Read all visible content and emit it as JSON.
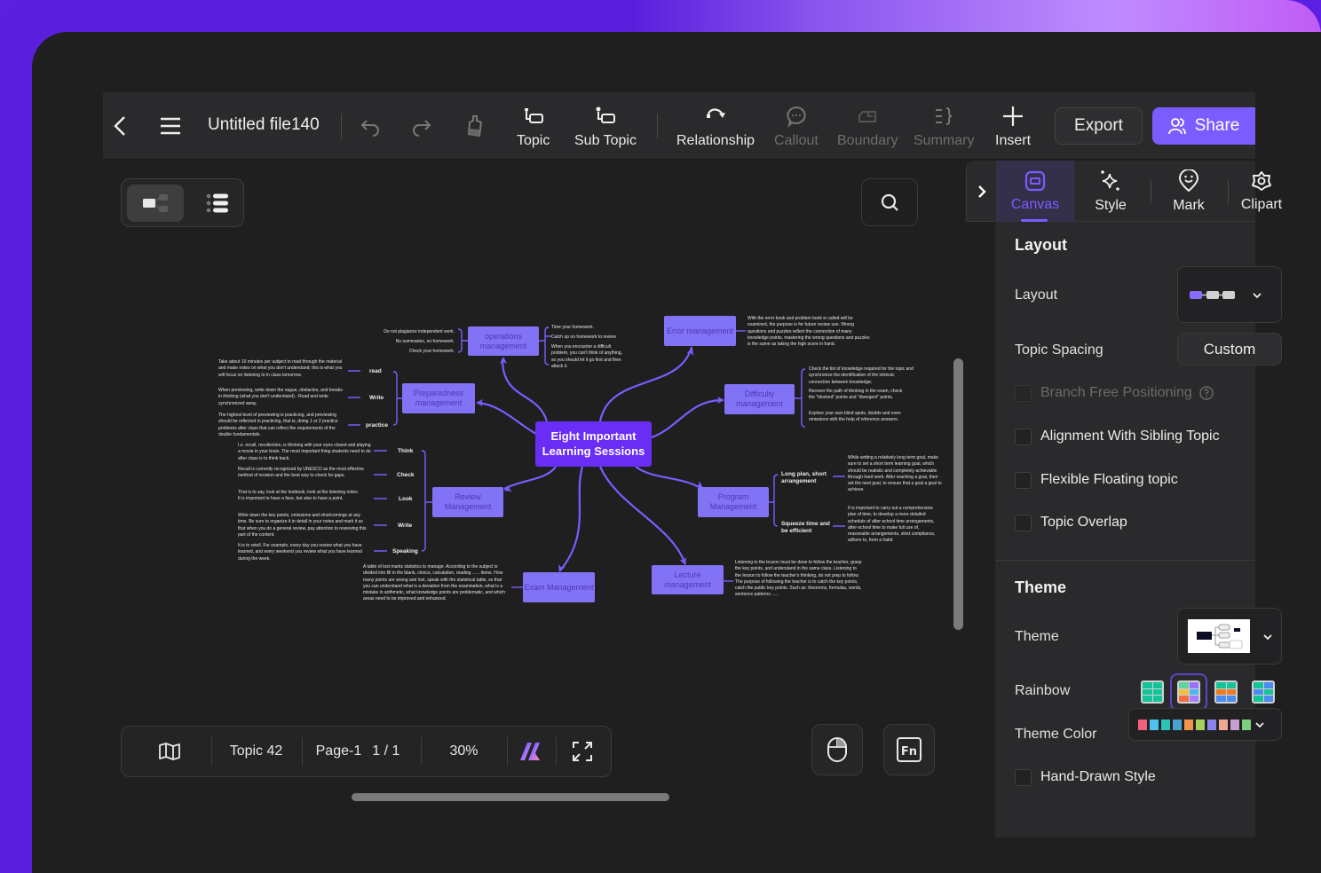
{
  "toolbar": {
    "back_icon": "chevron-left-icon",
    "menu_icon": "hamburger-menu-icon",
    "file_title": "Untitled file140",
    "undo_icon": "undo-icon",
    "redo_icon": "redo-icon",
    "format_painter_icon": "format-painter-icon",
    "tools": [
      {
        "label": "Topic",
        "icon": "topic-icon",
        "enabled": true
      },
      {
        "label": "Sub Topic",
        "icon": "sub-topic-icon",
        "enabled": true
      },
      {
        "label": "Relationship",
        "icon": "relationship-icon",
        "enabled": true
      },
      {
        "label": "Callout",
        "icon": "callout-icon",
        "enabled": false
      },
      {
        "label": "Boundary",
        "icon": "boundary-icon",
        "enabled": false
      },
      {
        "label": "Summary",
        "icon": "summary-icon",
        "enabled": false
      },
      {
        "label": "Insert",
        "icon": "plus-icon",
        "enabled": true
      }
    ],
    "export_label": "Export",
    "share_label": "Share"
  },
  "canvas": {
    "view_modes": [
      "mind-map-view",
      "outline-view"
    ],
    "active_view": "mind-map-view",
    "search_icon": "search-icon"
  },
  "mindmap": {
    "root": "Eight Important Learning Sessions",
    "branches": {
      "operations": {
        "title": "operations management",
        "left_notes": [
          "Do not plagiarize independent work.",
          "No summaries, no homework.",
          "Check your homework."
        ],
        "right_notes": [
          "Time your homework.",
          "Catch up on homework to review",
          "When you encounter a difficult problem, you can't think of anything, so you should let it go first and then attack it."
        ]
      },
      "error": {
        "title": "Error management",
        "note": "With the error book and problem book is called will be examined, the purpose is for future review use. Wrong questions and puzzles reflect the connection of many knowledge points, mastering the wrong questions and puzzles is the same as taking the high score in hand."
      },
      "preparedness": {
        "title": "Preparedness management",
        "subs": [
          {
            "label": "read",
            "note": "Take about 10 minutes per subject to read through the material and make notes on what you don't understand; this is what you will focus on listening to in class tomorrow."
          },
          {
            "label": "Write",
            "note": "When previewing, write down the vague, obstacles, and breaks in thinking (what you don't understand). -Read and write synchronized away."
          },
          {
            "label": "practice",
            "note": "The highest level of previewing is practicing, and previewing should be reflected in practicing, that is, doing 1 or 2 practice problems after class that can reflect the requirements of the double fundamentals."
          }
        ]
      },
      "difficulty": {
        "title": "Difficulty management",
        "notes": [
          "Check the list of knowledge required for the topic and synchronize the identification of the intrinsic connection between knowledge;",
          "Recover the path of thinking in the exam, check the \"blocked\" points and \"divergent\" points.",
          "Explore your own blind spots, doubts and even omissions with the help of reference answers."
        ]
      },
      "review": {
        "title": "Review Management",
        "subs": [
          {
            "label": "Think",
            "note": "I.e. recall, recollection, is thinking with your eyes closed and playing a movie in your brain. The most important thing students need to do after class is to think back."
          },
          {
            "label": "Check",
            "note": "Recall is currently recognized by UNESCO as the most effective method of revision and the best way to check for gaps."
          },
          {
            "label": "Look",
            "note": "That is to say, look at the textbook, look at the listening notes. It is important to have a face, but also to have a point."
          },
          {
            "label": "Write",
            "note": "Write down the key points, omissions and shortcomings at any time. Be sure to organize it in detail in your notes and mark it so that when you do a general review, pay attention to reviewing this part of the content."
          },
          {
            "label": "Speaking",
            "note": "It is to retell. For example, every day you review what you have learned, and every weekend you review what you have learned during the week."
          }
        ]
      },
      "program": {
        "title": "Program Management",
        "subs": [
          {
            "label": "Long plan, short arrangement",
            "note": "While setting a relatively long term goal, make sure to set a short term learning goal, which should be realistic and completely achievable through hard work. After reaching a goal, then set the next goal, to ensure that a goal a goal to achieve."
          },
          {
            "label": "Squeeze time and be efficient",
            "note": "It is important to carry out a comprehensive plan of time, to develop a more detailed schedule of after-school time arrangements, after-school time to make full use of, reasonable arrangements, strict compliance, adhere to, form a habit."
          }
        ]
      },
      "exam": {
        "title": "Exam Management",
        "note": "A table of lost marks statistics to manage. According to the subject is divided into fill in the blank, choice, calculation, reading ...... items. How many points are wrong and lost, speak with the statistical table, so that you can understand what is a deviation from the examination, what is a mistake in arithmetic, what knowledge points are problematic, and which areas need to be improved and enhanced."
      },
      "lecture": {
        "title": "Lecture management",
        "note": "Listening to the lesson must be done to follow the teacher, grasp the key points, and understand in the same class. Listening to the lesson to follow the teacher's thinking, do not prep to follow. The purpose of following the teacher is to catch the key points, catch the public key points. Such as: theorems, formulas, words, sentence patterns ......"
      }
    }
  },
  "bottombar": {
    "map_icon": "map-icon",
    "topic_count": "Topic 42",
    "page_label": "Page-1",
    "page_count": "1 / 1",
    "zoom": "30%",
    "ai_icon": "ai-logo-icon",
    "fullscreen_icon": "fullscreen-icon",
    "mouse_icon": "mouse-icon",
    "fn_icon": "function-key-icon"
  },
  "panel": {
    "tabs": [
      {
        "label": "Canvas",
        "icon": "canvas-icon",
        "active": true
      },
      {
        "label": "Style",
        "icon": "sparkle-icon",
        "active": false
      },
      {
        "label": "Mark",
        "icon": "mark-icon",
        "active": false
      },
      {
        "label": "Clipart",
        "icon": "clipart-icon",
        "active": false
      }
    ],
    "layout_section": {
      "title": "Layout",
      "layout_label": "Layout",
      "topic_spacing_label": "Topic Spacing",
      "topic_spacing_value": "Custom",
      "checkboxes": [
        {
          "label": "Branch Free Positioning",
          "checked": false,
          "disabled": true,
          "help": true
        },
        {
          "label": "Alignment With Sibling Topic",
          "checked": false,
          "disabled": false
        },
        {
          "label": "Flexible Floating topic",
          "checked": false,
          "disabled": false
        },
        {
          "label": "Topic Overlap",
          "checked": false,
          "disabled": false
        }
      ]
    },
    "theme_section": {
      "title": "Theme",
      "theme_label": "Theme",
      "rainbow_label": "Rainbow",
      "rainbow_selected_index": 1,
      "theme_color_label": "Theme Color",
      "theme_colors": [
        "#f0607a",
        "#4fc1f0",
        "#2cc4b8",
        "#48a4cf",
        "#f0944a",
        "#a7d05a",
        "#8a84e8",
        "#f0a890",
        "#c8a0d0",
        "#7ccf7e"
      ],
      "hand_drawn_label": "Hand-Drawn Style",
      "hand_drawn_checked": false
    }
  },
  "colors": {
    "accent": "#7b5cff",
    "root_node": "#6a2df5",
    "branch_node": "#8272f6",
    "connector": "#7b5cff"
  }
}
